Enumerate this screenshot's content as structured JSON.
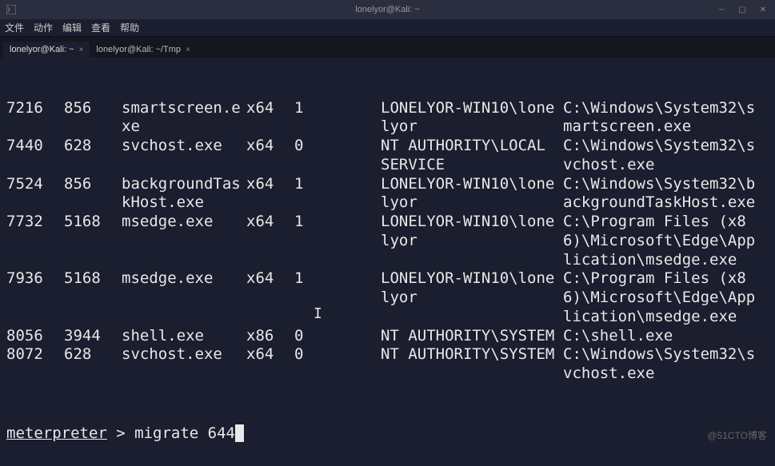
{
  "window": {
    "title": "lonelyor@Kali: ~"
  },
  "menu": {
    "file": "文件",
    "actions": "动作",
    "edit": "编辑",
    "view": "查看",
    "help": "帮助"
  },
  "tabs": [
    {
      "label": "lonelyor@Kali: ~",
      "active": true
    },
    {
      "label": "lonelyor@Kali: ~/Tmp",
      "active": false
    }
  ],
  "processes": [
    {
      "pid": "7216",
      "ppid": "856",
      "name": "smartscreen.exe",
      "arch": "x64",
      "session": "1",
      "user": "LONELYOR-WIN10\\lonelyor",
      "path": "C:\\Windows\\System32\\smartscreen.exe"
    },
    {
      "pid": "7440",
      "ppid": "628",
      "name": "svchost.exe",
      "arch": "x64",
      "session": "0",
      "user": "NT AUTHORITY\\LOCAL SERVICE",
      "path": "C:\\Windows\\System32\\svchost.exe"
    },
    {
      "pid": "7524",
      "ppid": "856",
      "name": "backgroundTaskHost.exe",
      "arch": "x64",
      "session": "1",
      "user": "LONELYOR-WIN10\\lonelyor",
      "path": "C:\\Windows\\System32\\backgroundTaskHost.exe"
    },
    {
      "pid": "7732",
      "ppid": "5168",
      "name": "msedge.exe",
      "arch": "x64",
      "session": "1",
      "user": "LONELYOR-WIN10\\lonelyor",
      "path": "C:\\Program Files (x86)\\Microsoft\\Edge\\Application\\msedge.exe"
    },
    {
      "pid": "7936",
      "ppid": "5168",
      "name": "msedge.exe",
      "arch": "x64",
      "session": "1",
      "user": "LONELYOR-WIN10\\lonelyor",
      "path": "C:\\Program Files (x86)\\Microsoft\\Edge\\Application\\msedge.exe"
    },
    {
      "pid": "8056",
      "ppid": "3944",
      "name": "shell.exe",
      "arch": "x86",
      "session": "0",
      "user": "NT AUTHORITY\\SYSTEM",
      "path": "C:\\shell.exe"
    },
    {
      "pid": "8072",
      "ppid": "628",
      "name": "svchost.exe",
      "arch": "x64",
      "session": "0",
      "user": "NT AUTHORITY\\SYSTEM",
      "path": "C:\\Windows\\System32\\svchost.exe"
    }
  ],
  "prompt": {
    "label": "meterpreter",
    "separator": " > ",
    "command": "migrate 644"
  },
  "watermark": "@51CTO博客"
}
